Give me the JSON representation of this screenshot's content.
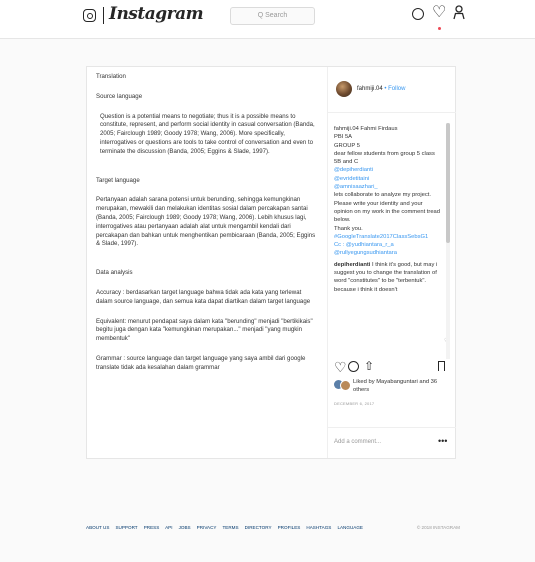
{
  "header": {
    "logo_text": "Instagram",
    "search_placeholder": "Q Search",
    "icons": [
      "camera-icon",
      "explore-icon",
      "heart-icon",
      "person-icon"
    ]
  },
  "post": {
    "title": "Translation",
    "source_heading": "Source language",
    "source_text": "Question is a potential means to negotiate; thus it is a possible means to constitute, represent, and perform social identity in casual conversation (Banda, 2005; Fairclough 1989; Goody 1978; Wang, 2006). More specifically, interrogatives or questions are tools to take control of conversation and even to terminate the discussion (Banda, 2005; Eggins & Slade, 1997).",
    "target_heading": "Target language",
    "target_text": "Pertanyaan adalah sarana potensi untuk berunding, sehingga kemungkinan merupakan, mewakili dan melakukan identitas sosial dalam percakapan santai (Banda, 2005; Fairclough 1989; Goody 1978; Wang, 2006). Lebih khusus lagi, interrogatives atau pertanyaan adalah alat untuk mengambil kendali dari percakapan dan bahkan untuk menghentikan pembicaraan (Banda, 2005; Eggins & Slade, 1997).",
    "analysis_heading": "Data analysis",
    "accuracy": "Accuracy : berdasarkan target language bahwa tidak ada kata yang terlewat dalam source language, dan semua kata dapat diartikan dalam target language",
    "equivalent": "Equivalent: menurut pendapat saya dalam kata \"berunding\" menjadi \"bertikikais\" begitu juga dengan kata \"kemungkinan merupakan...\" menjadi \"yang mugkin membentuk\"",
    "grammar": "Grammar : source language dan target language yang saya ambil dari google translate tidak ada kesalahan dalam grammar"
  },
  "sidebar": {
    "username": "fahmiji.04",
    "follow_label": "• Follow",
    "caption_lines": [
      "fahmiji.04 Fahmi Firdaus",
      "PBI 5A",
      "GROUP 5",
      "dear fellow students from group 5 class 5B and C"
    ],
    "mentions": [
      "@depiherdianti",
      "@evridetitaini",
      "@amnisaazhari_"
    ],
    "caption_lines_2": [
      "lets collaborate to analyze my project.",
      "Please write your identity and your opinion on my work in the comment tread below.",
      "Thank you."
    ],
    "hashtag": "#GoogleTranslate2017ClassSebsG1",
    "cc": "Cc : @yudhiantara_r_a",
    "cc_mention": "@rullyegungsudhiantara",
    "comment_user": "depiherdianti",
    "comment_text": "I think it's good, but may i suggest you to change the translation of word \"constitutes\" to be \"terbentuk\". because i think it doesn't",
    "likes_text": "Liked by Mayabanguntari and 36 others",
    "date": "DECEMBER 6, 2017",
    "add_comment_placeholder": "Add a comment...",
    "more_label": "•••"
  },
  "footer": {
    "links": [
      "ABOUT US",
      "SUPPORT",
      "PRESS",
      "API",
      "JOBS",
      "PRIVACY",
      "TERMS",
      "DIRECTORY",
      "PROFILES",
      "HASHTAGS",
      "LANGUAGE"
    ],
    "copyright": "© 2018 INSTAGRAM"
  }
}
